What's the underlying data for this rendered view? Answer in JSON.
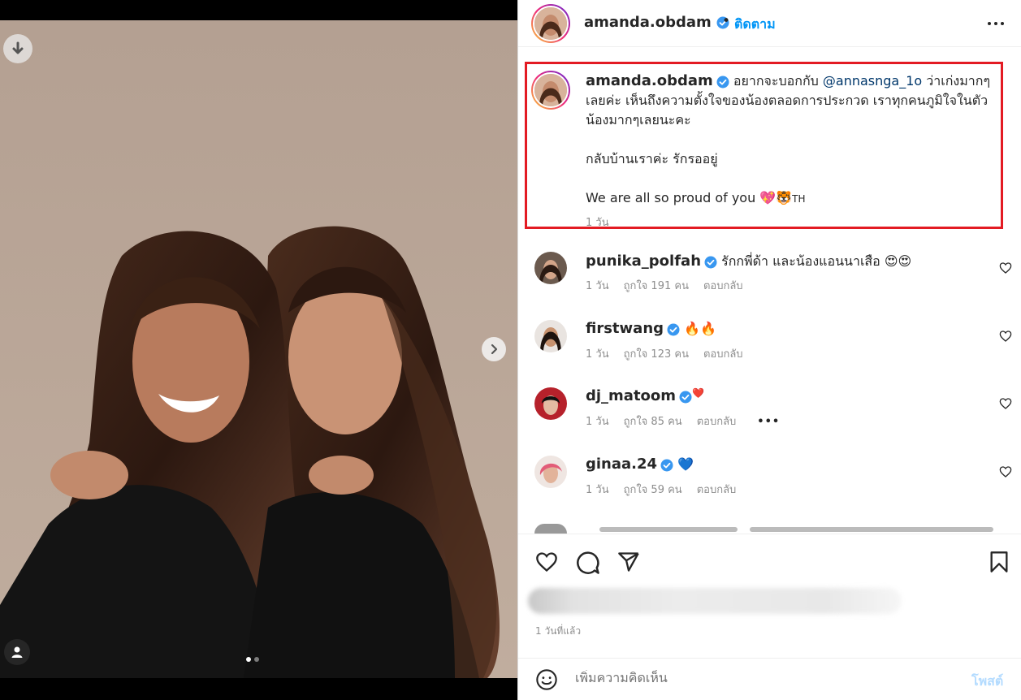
{
  "post": {
    "author": "amanda.obdam",
    "follow_label": "ติดตาม",
    "separator": "•",
    "caption": {
      "line1_pre": "อยากจะบอกกับ",
      "mention": "@annasnga_1o",
      "line1_post": "ว่าเก่งมากๆ เลยค่ะ เห็นถึงความตั้งใจของน้องตลอดการประกวด เราทุกคนภูมิใจในตัวน้องมากๆเลยนะคะ",
      "para2": "กลับบ้านเราค่ะ รักรออยู่",
      "para3": "We are all so proud of you",
      "para3_emoji": "💖🐯",
      "para3_suffix": "TH",
      "time": "1 วัน"
    },
    "slides": {
      "total": 2,
      "current": 1
    }
  },
  "comments": [
    {
      "user": "punika_polfah",
      "verified": true,
      "text": "รักกพี่ด้า และน้องแอนนาเสือ",
      "emoji": "😍😍",
      "time": "1 วัน",
      "likes": "ถูกใจ 191 คน",
      "reply": "ตอบกลับ",
      "more": ""
    },
    {
      "user": "firstwang",
      "verified": true,
      "text": "",
      "emoji": "🔥🔥",
      "time": "1 วัน",
      "likes": "ถูกใจ 123 คน",
      "reply": "ตอบกลับ",
      "more": ""
    },
    {
      "user": "dj_matoom",
      "verified": true,
      "text": "",
      "emoji": "❤️",
      "time": "1 วัน",
      "likes": "ถูกใจ 85 คน",
      "reply": "ตอบกลับ",
      "more": "•••"
    },
    {
      "user": "ginaa.24",
      "verified": true,
      "text": "",
      "emoji": "💙",
      "time": "1 วัน",
      "likes": "ถูกใจ 59 คน",
      "reply": "ตอบกลับ",
      "more": ""
    }
  ],
  "footer": {
    "post_time": "1 วันที่แล้ว",
    "comment_placeholder": "เพิ่มความคิดเห็น",
    "post_button": "โพสต์"
  },
  "icons": {
    "download": "download-icon",
    "next": "chevron-right-icon",
    "tag": "user-tag-icon",
    "verified": "verified-badge-icon",
    "more": "more-horizontal-icon",
    "heart": "heart-icon",
    "comment": "comment-icon",
    "share": "share-icon",
    "save": "bookmark-icon",
    "emoji": "emoji-icon"
  },
  "colors": {
    "link": "#0095f6",
    "verified": "#3897f0",
    "highlight_border": "#e31b23",
    "muted": "#8e8e8e",
    "post_disabled": "#b3dbff"
  }
}
